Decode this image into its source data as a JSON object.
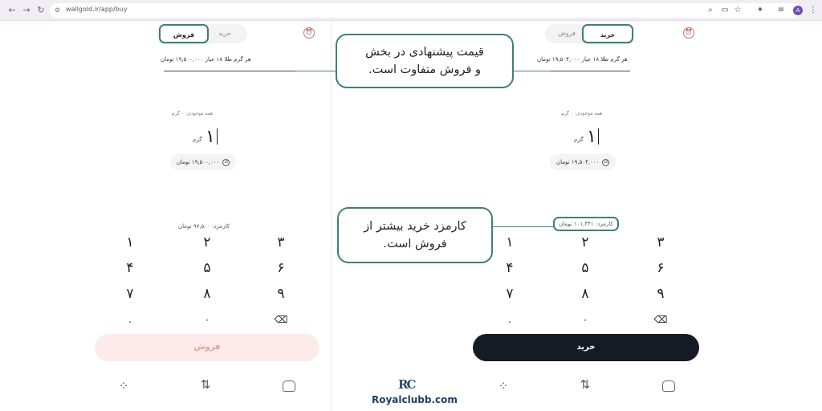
{
  "browser": {
    "url": "wallgold.ir/app/buy",
    "avatar_letter": "A"
  },
  "left_panel": {
    "tabs": [
      {
        "label": "خرید",
        "active": false
      },
      {
        "label": "فروش",
        "active": true
      }
    ],
    "price_text": "هر گرم طلا ۱۸ عیار ۱۹,۵۰۰,۰۰۰ تومان",
    "balance_text": "همه موجودی: ۰ گرم",
    "amount_value": "۱",
    "amount_unit": "گرم",
    "toman_value": "۱۹,۵۰۰,۰۰۰ تومان",
    "fee_text": "کارمزد: ۹۷,۵۰۰ تومان",
    "cta_label": "فروش"
  },
  "right_panel": {
    "tabs": [
      {
        "label": "خرید",
        "active": true
      },
      {
        "label": "فروش",
        "active": false
      }
    ],
    "price_text": "هر گرم طلا ۱۸ عیار ۱۹,۵۰۴,۰۰۰ تومان",
    "balance_text": "همه موجودی: ۰ گرم",
    "amount_value": "۱",
    "amount_unit": "گرم",
    "toman_value": "۱۹,۵۰۴,۰۰۰ تومان",
    "fee_text": "کارمزد: ۱۰۱,۴۴۱ تومان",
    "cta_label": "خرید"
  },
  "keypad": {
    "rows": [
      [
        "۱",
        "۲",
        "۳"
      ],
      [
        "۴",
        "۵",
        "۶"
      ],
      [
        "۷",
        "۸",
        "۹"
      ],
      [
        ".",
        "۰",
        "⌫"
      ]
    ]
  },
  "callouts": {
    "price_note": "قیمت پیشنهادی در بخش\nو فروش متفاوت است.",
    "fee_note": "کارمزد خرید بیشتر از\nفروش است."
  },
  "watermark": {
    "logo": "RC",
    "site": "Royalclubb.com"
  },
  "colors": {
    "accent": "#3f7e78",
    "buy_button": "#151b24",
    "sell_button": "#fdeaea",
    "sell_text": "#e79a9a"
  },
  "icons": [
    "back-arrow-icon",
    "forward-arrow-icon",
    "reload-icon",
    "alarm-icon",
    "swap-icon",
    "apps-icon",
    "home-icon",
    "backspace-icon"
  ]
}
